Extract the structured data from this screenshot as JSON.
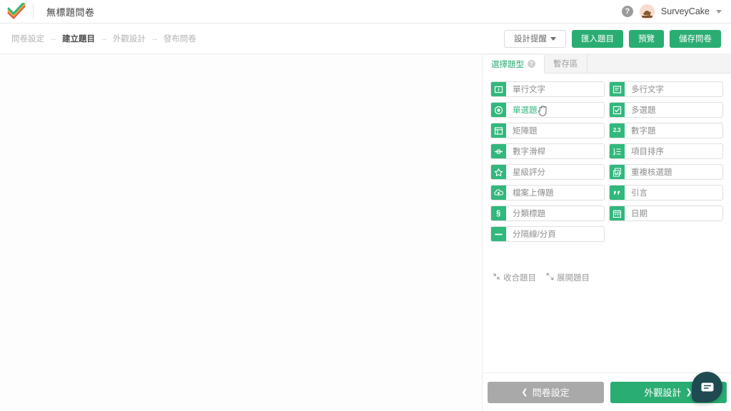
{
  "topbar": {
    "logo_name": "surveycake-logo",
    "doc_title": "無標題問卷",
    "help_glyph": "?",
    "user_name": "SurveyCake"
  },
  "breadcrumb": {
    "arrow": "→",
    "items": [
      {
        "label": "問卷設定",
        "active": false
      },
      {
        "label": "建立題目",
        "active": true
      },
      {
        "label": "外觀設計",
        "active": false
      },
      {
        "label": "發布問卷",
        "active": false
      }
    ]
  },
  "actions": {
    "design_tips": "設計提醒",
    "import_questions": "匯入題目",
    "preview": "預覽",
    "save_survey": "儲存問卷"
  },
  "panel": {
    "tabs": [
      {
        "label": "選擇題型",
        "active": true,
        "help_glyph": "?"
      },
      {
        "label": "暫存區",
        "active": false,
        "help_glyph": ""
      }
    ],
    "question_types": [
      {
        "label": "單行文字",
        "icon": "single-line-text-icon",
        "hovered": false
      },
      {
        "label": "多行文字",
        "icon": "multi-line-text-icon",
        "hovered": false
      },
      {
        "label": "單選題",
        "icon": "radio-button-icon",
        "hovered": true
      },
      {
        "label": "多選題",
        "icon": "checkbox-icon",
        "hovered": false
      },
      {
        "label": "矩陣題",
        "icon": "matrix-icon",
        "hovered": false
      },
      {
        "label": "數字題",
        "icon": "number-icon",
        "hovered": false
      },
      {
        "label": "數字滑桿",
        "icon": "slider-icon",
        "hovered": false
      },
      {
        "label": "項目排序",
        "icon": "ranking-icon",
        "hovered": false
      },
      {
        "label": "星級評分",
        "icon": "star-rating-icon",
        "hovered": false
      },
      {
        "label": "重複核選題",
        "icon": "repeat-checkbox-icon",
        "hovered": false
      },
      {
        "label": "檔案上傳題",
        "icon": "file-upload-icon",
        "hovered": false
      },
      {
        "label": "引言",
        "icon": "quote-icon",
        "hovered": false
      },
      {
        "label": "分類標題",
        "icon": "section-title-icon",
        "hovered": false
      },
      {
        "label": "日期",
        "icon": "calendar-icon",
        "hovered": false
      },
      {
        "label": "分隔線/分頁",
        "icon": "divider-icon",
        "hovered": false
      }
    ],
    "number_icon_text": "2.3",
    "section_icon_text": "§",
    "toggles": [
      {
        "label": "收合題目",
        "icon": "collapse-icon"
      },
      {
        "label": "展開題目",
        "icon": "expand-icon"
      }
    ],
    "footer": {
      "prev_label": "問卷設定",
      "prev_chevron": "❮",
      "next_label": "外觀設計",
      "next_chevron": "❯"
    }
  },
  "chat": {
    "name": "chat-bubble-fab"
  },
  "colors": {
    "brand_green": "#2aad72",
    "icon_green": "#31b87c",
    "gray_button": "#a9a9a9",
    "fab_dark": "#1f4a52"
  }
}
